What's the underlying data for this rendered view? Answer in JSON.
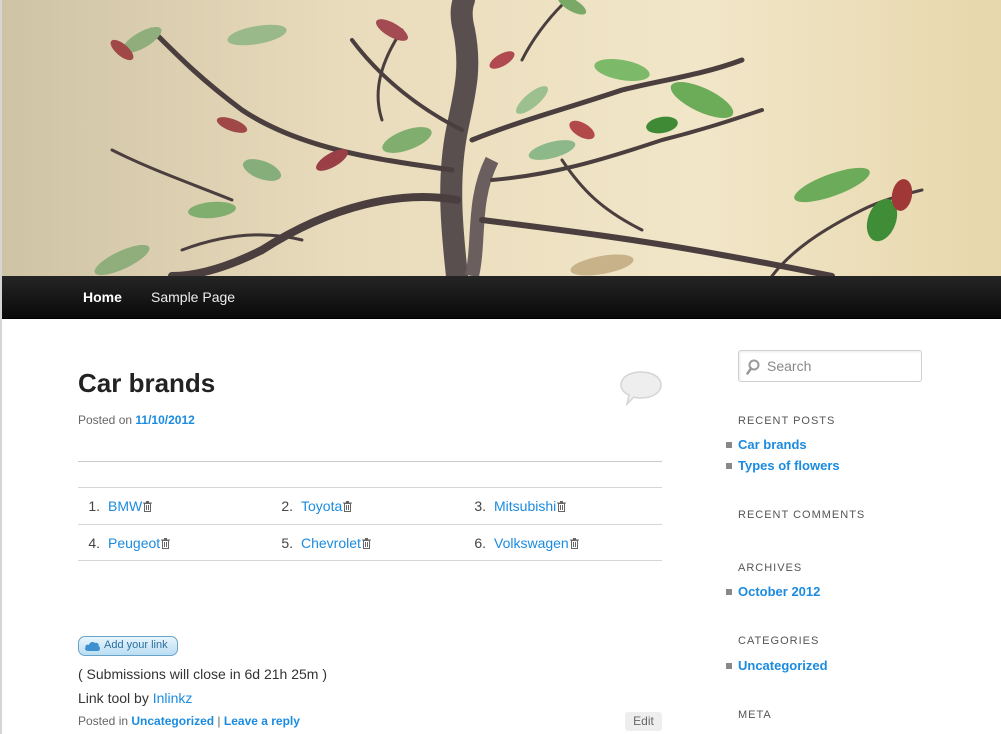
{
  "nav": {
    "home": "Home",
    "sample_page": "Sample Page"
  },
  "post": {
    "title": "Car brands",
    "posted_on_prefix": "Posted on",
    "date": "11/10/2012",
    "links": [
      {
        "num": "1.",
        "label": "BMW"
      },
      {
        "num": "2.",
        "label": "Toyota"
      },
      {
        "num": "3.",
        "label": "Mitsubishi"
      },
      {
        "num": "4.",
        "label": "Peugeot"
      },
      {
        "num": "5.",
        "label": "Chevrolet"
      },
      {
        "num": "6.",
        "label": "Volkswagen"
      }
    ],
    "add_link_button": "Add your link",
    "submissions_text": "( Submissions will close in 6d 21h 25m )",
    "link_tool_prefix": "Link tool by",
    "link_tool_name": "Inlinkz",
    "footer_posted_in": "Posted in",
    "footer_category": "Uncategorized",
    "footer_separator": "|",
    "footer_reply": "Leave a reply",
    "edit_label": "Edit"
  },
  "sidebar": {
    "search_placeholder": "Search",
    "recent_posts_title": "Recent Posts",
    "recent_posts": [
      "Car brands",
      "Types of flowers"
    ],
    "recent_comments_title": "Recent Comments",
    "archives_title": "Archives",
    "archives": [
      "October 2012"
    ],
    "categories_title": "Categories",
    "categories": [
      "Uncategorized"
    ],
    "meta_title": "Meta"
  },
  "icons": {
    "comment": "comment-bubble-icon",
    "trash": "trash-icon",
    "search": "search-icon",
    "cloud": "cloud-icon"
  },
  "colors": {
    "link": "#1b8be0",
    "navbar": "#0a0a0a",
    "header_bg": "#efe3c4"
  }
}
